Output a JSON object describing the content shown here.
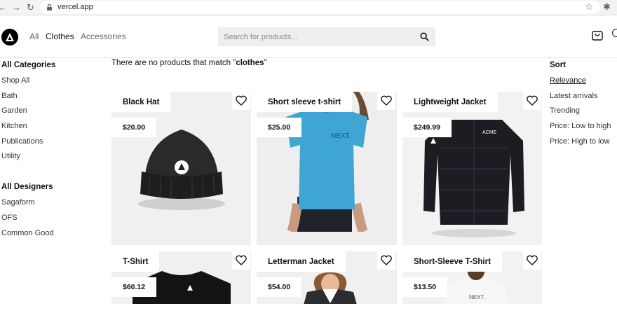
{
  "browser": {
    "url": "vercel.app",
    "back_icon": "back-arrow-icon",
    "forward_icon": "forward-arrow-icon",
    "reload_icon": "reload-icon"
  },
  "header": {
    "nav": [
      "All",
      "Clothes",
      "Accessories"
    ],
    "active_nav": "Clothes",
    "search_placeholder": "Search for products..."
  },
  "sidebar": {
    "categories_title": "All Categories",
    "categories": [
      "Shop All",
      "Bath",
      "Garden",
      "Kitchen",
      "Publications",
      "Utility"
    ],
    "designers_title": "All Designers",
    "designers": [
      "Sagaform",
      "OFS",
      "Common Good"
    ]
  },
  "message": {
    "prefix": "There are no products that match \"",
    "query": "clothes",
    "suffix": "\""
  },
  "sort": {
    "title": "Sort",
    "options": [
      "Relevance",
      "Latest arrivals",
      "Trending",
      "Price: Low to high",
      "Price: High to low"
    ],
    "active": "Relevance"
  },
  "products": [
    {
      "name": "Black Hat",
      "price": "$20.00"
    },
    {
      "name": "Short sleeve t-shirt",
      "price": "$25.00"
    },
    {
      "name": "Lightweight Jacket",
      "price": "$249.99"
    },
    {
      "name": "T-Shirt",
      "price": "$60.12"
    },
    {
      "name": "Letterman Jacket",
      "price": "$54.00"
    },
    {
      "name": "Short-Sleeve T-Shirt",
      "price": "$13.50"
    }
  ],
  "colors": {
    "accent": "#000000",
    "card_bg": "#f2f2f2",
    "tshirt_blue": "#3fa6d4"
  }
}
